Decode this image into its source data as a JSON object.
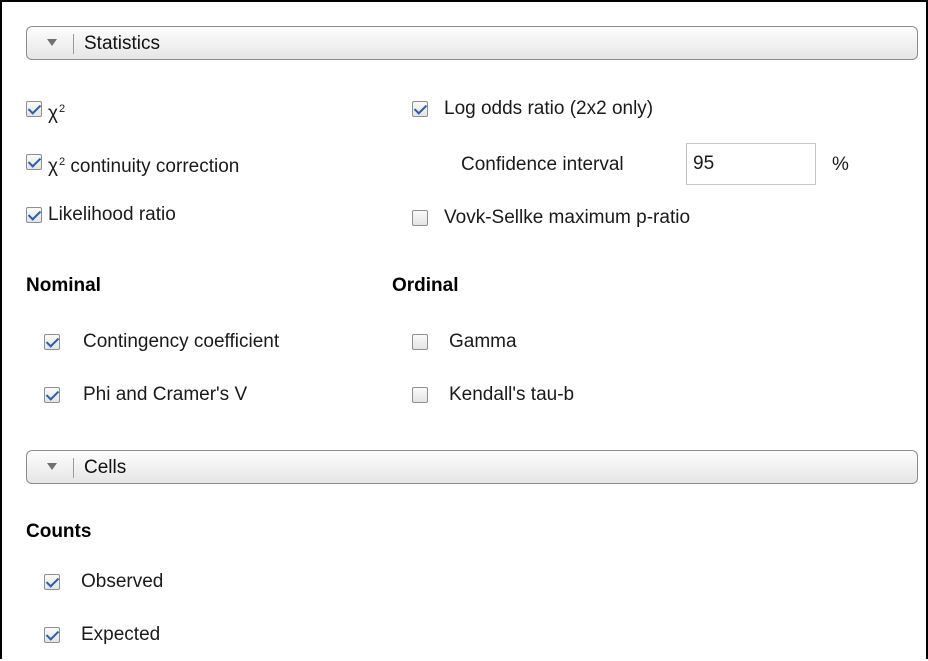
{
  "statistics": {
    "header": "Statistics",
    "chi2": {
      "symbol": "χ",
      "sup": "2",
      "checked": true
    },
    "chi2_cc": {
      "symbol": "χ",
      "sup": "2",
      "label": " continuity correction",
      "checked": true
    },
    "likelihood": {
      "label": "Likelihood ratio",
      "checked": true
    },
    "log_odds": {
      "label": "Log odds ratio  (2x2 only)",
      "checked": true
    },
    "confidence": {
      "label": "Confidence interval",
      "value": "95",
      "unit": "%"
    },
    "vovk": {
      "label": "Vovk-Sellke maximum p-ratio",
      "checked": false
    },
    "nominal": {
      "heading": "Nominal",
      "items": [
        {
          "label": "Contingency coefficient",
          "checked": true
        },
        {
          "label": "Phi and Cramer's V",
          "checked": true
        }
      ]
    },
    "ordinal": {
      "heading": "Ordinal",
      "items": [
        {
          "label": "Gamma",
          "checked": false
        },
        {
          "label": "Kendall's tau-b",
          "checked": false
        }
      ]
    }
  },
  "cells": {
    "header": "Cells",
    "counts": {
      "heading": "Counts",
      "items": [
        {
          "label": "Observed",
          "checked": true
        },
        {
          "label": "Expected",
          "checked": true
        }
      ]
    }
  },
  "colors": {
    "check": "#2b5fae",
    "border": "#8c8c8c"
  }
}
